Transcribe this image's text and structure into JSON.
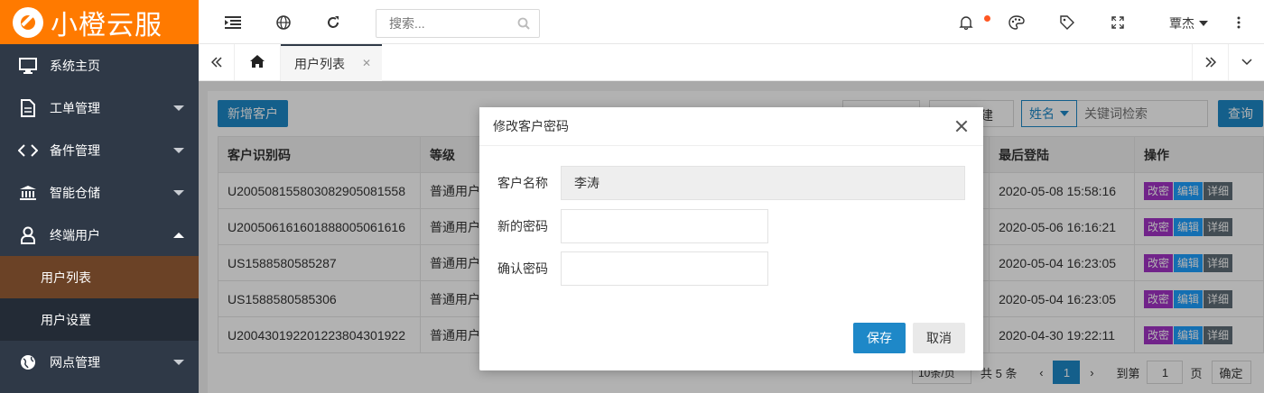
{
  "app": {
    "logo_text": "小橙云服"
  },
  "sidebar": {
    "items": [
      {
        "label": "系统主页",
        "icon": "monitor-icon"
      },
      {
        "label": "工单管理",
        "icon": "document-icon"
      },
      {
        "label": "备件管理",
        "icon": "code-icon"
      },
      {
        "label": "智能仓储",
        "icon": "bank-icon"
      },
      {
        "label": "终端用户",
        "icon": "user-icon"
      },
      {
        "label": "网点管理",
        "icon": "globe-icon"
      }
    ],
    "sub_items": [
      {
        "label": "用户列表",
        "active": true
      },
      {
        "label": "用户设置",
        "active": false
      }
    ]
  },
  "header": {
    "search_placeholder": "搜索...",
    "user_name": "覃杰",
    "icons": [
      "menu-icon",
      "globe-icon",
      "refresh-icon",
      "bell-icon",
      "palette-icon",
      "tag-icon",
      "fullscreen-icon",
      "more-icon"
    ]
  },
  "tabs": {
    "active_label": "用户列表"
  },
  "toolbar": {
    "add_label": "新增客户",
    "filter_b_text": "建",
    "field_select": "姓名",
    "keyword_placeholder": "关键词检索",
    "query_label": "查询"
  },
  "table": {
    "headers": [
      "客户识别码",
      "等级",
      "最后登陆",
      "操作"
    ],
    "rows": [
      {
        "id": "U20050815580308290508155​8",
        "level": "普通用户",
        "last": "2020-05-08 15:58:16"
      },
      {
        "id": "U20050616160188800506161​6",
        "level": "普通用户",
        "last": "2020-05-06 16:16:21"
      },
      {
        "id": "US1588580585287",
        "level": "普通用户",
        "last": "2020-05-04 16:23:05"
      },
      {
        "id": "US1588580585306",
        "level": "普通用户",
        "last": "2020-05-04 16:23:05"
      },
      {
        "id": "U20043019220122380430192​2",
        "level": "普通用户",
        "last": "2020-04-30 19:22:11"
      }
    ],
    "actions": {
      "pwd": "改密",
      "edit": "编辑",
      "detail": "详细"
    }
  },
  "pager": {
    "page_size": "10条/页",
    "total": "共 5 条",
    "current_page": "1",
    "goto_label": "到第",
    "goto_value": "1",
    "page_unit": "页",
    "confirm": "确定"
  },
  "modal": {
    "title": "修改客户密码",
    "customer_name_label": "客户名称",
    "customer_name_value": "李涛",
    "new_password_label": "新的密码",
    "confirm_password_label": "确认密码",
    "save_label": "保存",
    "cancel_label": "取消"
  },
  "colors": {
    "brand_orange": "#ff7a00",
    "sidebar_bg": "#2f3947",
    "primary_blue": "#1e88c8",
    "active_sub": "#6b4226",
    "pwd_purple": "#a233c6",
    "edit_blue": "#1e9fff",
    "detail_gray": "#5f6e78"
  }
}
